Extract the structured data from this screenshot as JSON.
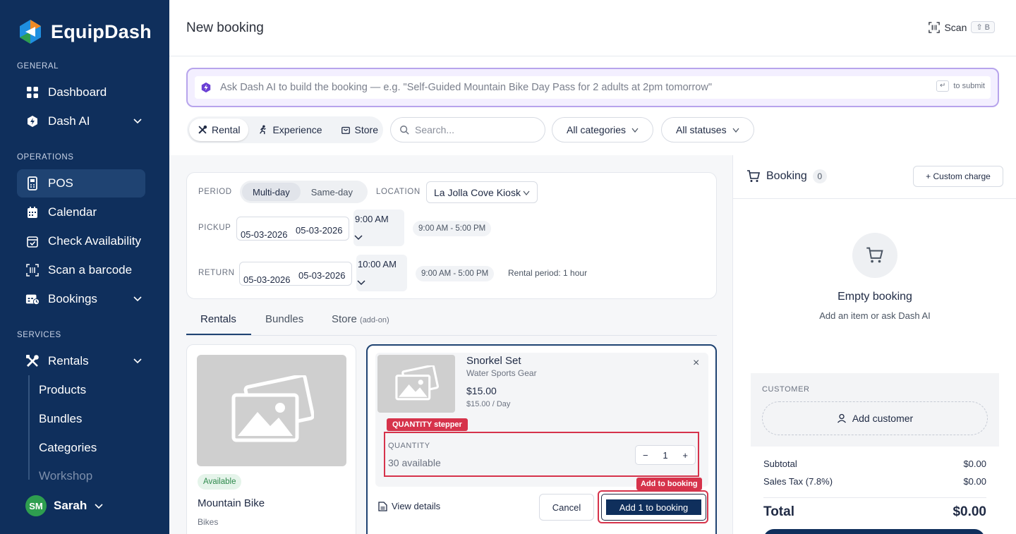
{
  "brand": {
    "name": "EquipDash"
  },
  "sidebar": {
    "general_title": "GENERAL",
    "operations_title": "OPERATIONS",
    "services_title": "SERVICES",
    "items": {
      "dashboard": "Dashboard",
      "dash_ai": "Dash AI",
      "pos": "POS",
      "calendar": "Calendar",
      "check_availability": "Check Availability",
      "scan_barcode": "Scan a barcode",
      "bookings": "Bookings",
      "rentals": "Rentals"
    },
    "rentals_sub": [
      "Products",
      "Bundles",
      "Categories",
      "Workshop"
    ],
    "user": {
      "initials": "SM",
      "name": "Sarah"
    }
  },
  "header": {
    "title": "New booking",
    "scan_label": "Scan",
    "scan_shortcut": "⇧ B"
  },
  "ai": {
    "placeholder": "Ask Dash AI to build the booking — e.g. \"Self-Guided Mountain Bike Day Pass for 2 adults at 2pm tomorrow\"",
    "submit_key": "↵",
    "submit_hint": "to submit"
  },
  "filters": {
    "types": [
      "Rental",
      "Experience",
      "Store"
    ],
    "search_placeholder": "Search...",
    "categories": "All categories",
    "statuses": "All statuses"
  },
  "period": {
    "period_label": "PERIOD",
    "options": [
      "Multi-day",
      "Same-day"
    ],
    "location_label": "LOCATION",
    "location": "La Jolla Cove Kiosk",
    "pickup_label": "PICKUP",
    "pickup_date": "05-03-2026",
    "pickup_date_alt": "05-03-2026",
    "pickup_time": "9:00 AM",
    "pickup_hours": "9:00 AM - 5:00 PM",
    "return_label": "RETURN",
    "return_date": "05-03-2026",
    "return_date_alt": "05-03-2026",
    "return_time": "10:00 AM",
    "return_hours": "9:00 AM - 5:00 PM",
    "rental_period": "Rental period: 1 hour"
  },
  "tabs": {
    "rentals": "Rentals",
    "bundles": "Bundles",
    "store": "Store",
    "store_note": "(add-on)"
  },
  "product": {
    "status": "Available",
    "name": "Mountain Bike",
    "category": "Bikes"
  },
  "selected": {
    "name": "Snorkel Set",
    "category": "Water Sports Gear",
    "price": "$15.00",
    "per_day": "$15.00 / Day",
    "close": "×",
    "qty_tag": "QUANTITY stepper",
    "qty_label": "QUANTITY",
    "qty_available": "30 available",
    "qty_minus": "−",
    "qty_value": "1",
    "qty_plus": "+",
    "view_details": "View details",
    "cancel": "Cancel",
    "add_tag": "Add to booking",
    "add_button": "Add 1 to booking"
  },
  "booking": {
    "title": "Booking",
    "count": "0",
    "custom_charge": "+ Custom charge",
    "empty_title": "Empty booking",
    "empty_sub": "Add an item or ask Dash AI",
    "customer_label": "CUSTOMER",
    "add_customer": "Add customer",
    "subtotal_label": "Subtotal",
    "subtotal": "$0.00",
    "tax_label": "Sales Tax (7.8%)",
    "tax": "$0.00",
    "total_label": "Total",
    "total": "$0.00"
  },
  "colors": {
    "sidebar": "#0f2f5c",
    "accent": "#1f4372",
    "ai_border": "#b7a4ec",
    "highlight": "#d6334b",
    "available": "#2f8a4d"
  }
}
